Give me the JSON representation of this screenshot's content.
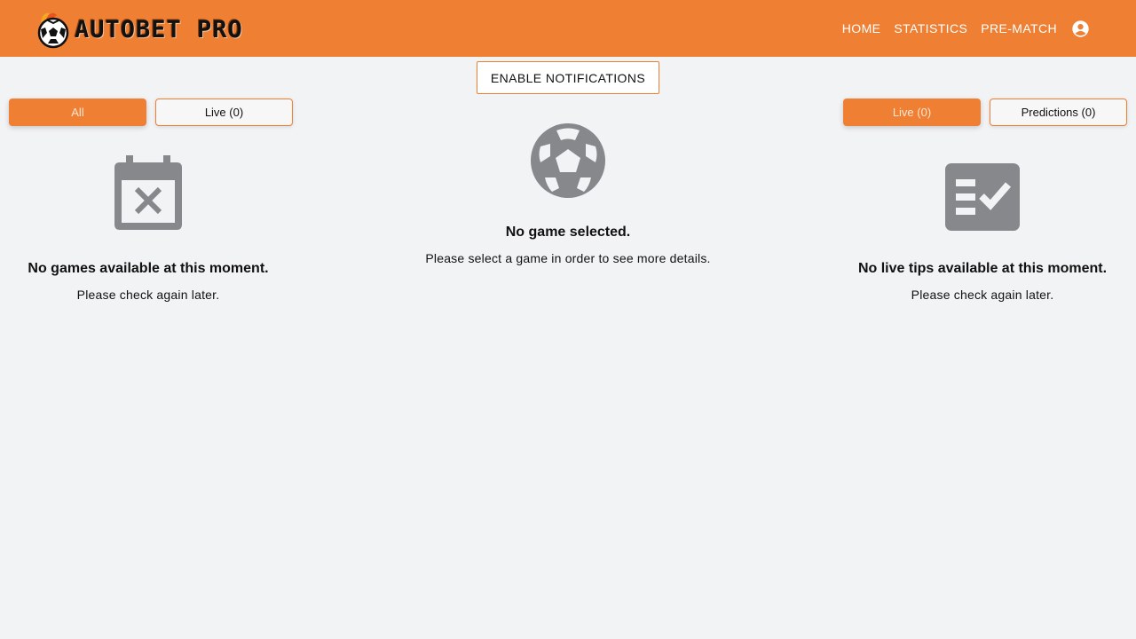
{
  "header": {
    "brand": "AUTOBET PRO",
    "nav": [
      "HOME",
      "STATISTICS",
      "PRE-MATCH"
    ],
    "account_icon": "account-circle-icon"
  },
  "notifications": {
    "button_label": "ENABLE NOTIFICATIONS"
  },
  "games_panel": {
    "tabs": [
      {
        "label": "All",
        "active": true
      },
      {
        "label": "Live (0)",
        "active": false
      }
    ],
    "icon": "calendar-remove-icon",
    "empty_title": "No games available at this moment.",
    "empty_subtitle": "Please check again later."
  },
  "details_panel": {
    "icon": "soccer-ball-icon",
    "empty_title": "No game selected.",
    "empty_subtitle": "Please select a game in order to see more details."
  },
  "tips_panel": {
    "tabs": [
      {
        "label": "Live (0)",
        "active": true
      },
      {
        "label": "Predictions (0)",
        "active": false
      }
    ],
    "icon": "checklist-icon",
    "empty_title": "No live tips available at this moment.",
    "empty_subtitle": "Please check again later."
  },
  "colors": {
    "accent": "#ef7f33",
    "background": "#f2f3f5",
    "icon_gray": "#87888b"
  }
}
